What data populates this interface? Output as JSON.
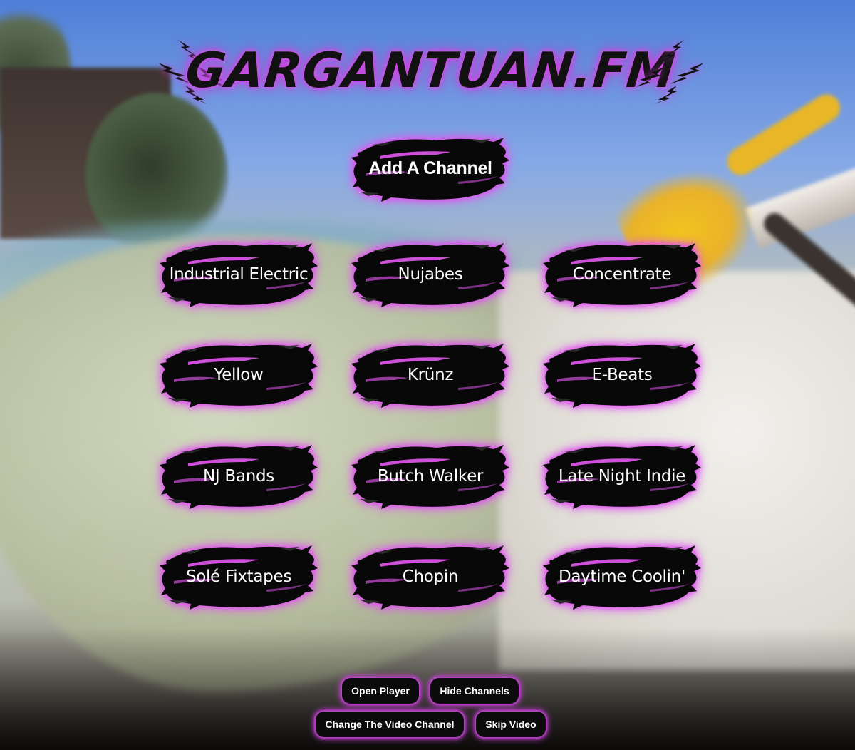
{
  "site": {
    "logo_text": "GARGANTUAN.FM",
    "glow_color": "#d446e4"
  },
  "add_channel": {
    "label": "Add A Channel"
  },
  "channels": [
    {
      "label": "Industrial Electric"
    },
    {
      "label": "Nujabes"
    },
    {
      "label": "Concentrate"
    },
    {
      "label": "Yellow"
    },
    {
      "label": "Krünz"
    },
    {
      "label": "E-Beats"
    },
    {
      "label": "NJ Bands"
    },
    {
      "label": "Butch Walker"
    },
    {
      "label": "Late Night Indie"
    },
    {
      "label": "Solé Fixtapes"
    },
    {
      "label": "Chopin"
    },
    {
      "label": "Daytime Coolin'"
    }
  ],
  "controls": {
    "open_player": "Open Player",
    "hide_channels": "Hide Channels",
    "change_video_channel": "Change The Video Channel",
    "skip_video": "Skip Video"
  }
}
